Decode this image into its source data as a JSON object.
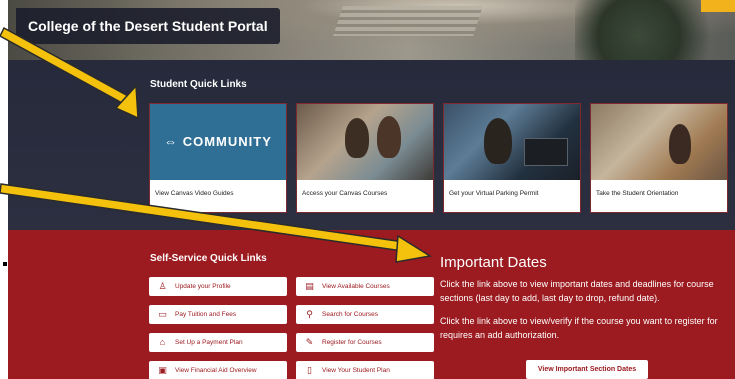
{
  "header": {
    "portal_title": "College of the Desert Student Portal"
  },
  "quick_links": {
    "heading": "Student Quick Links",
    "cards": [
      {
        "label": "View Canvas Video Guides",
        "image_text": "COMMUNITY"
      },
      {
        "label": "Access your Canvas Courses"
      },
      {
        "label": "Get your Virtual Parking Permit"
      },
      {
        "label": "Take the Student Orientation"
      }
    ]
  },
  "self_service": {
    "heading": "Self-Service Quick Links",
    "buttons": [
      {
        "label": "Update your Profile",
        "icon": "profile-icon"
      },
      {
        "label": "View Available Courses",
        "icon": "courses-icon"
      },
      {
        "label": "Pay Tuition and Fees",
        "icon": "credit-card-icon"
      },
      {
        "label": "Search for Courses",
        "icon": "search-icon"
      },
      {
        "label": "Set Up a Payment Plan",
        "icon": "bank-icon"
      },
      {
        "label": "Register for Courses",
        "icon": "edit-icon"
      },
      {
        "label": "View Financial Aid Overview",
        "icon": "document-icon"
      },
      {
        "label": "View Your Student Plan",
        "icon": "plan-icon"
      }
    ]
  },
  "important_dates": {
    "title": "Important Dates",
    "paragraph1": "Click the link above to view important dates and deadlines for course sections (last day to add, last day to drop, refund date).",
    "paragraph2": "Click the link above to view/verify if the course you want to register for requires an add authorization.",
    "button_label": "View Important Section Dates"
  },
  "colors": {
    "dark_band": "#262a3b",
    "red_band": "#9c1b20",
    "arrow_yellow": "#f4c20d",
    "community_blue": "#2f6f95"
  }
}
